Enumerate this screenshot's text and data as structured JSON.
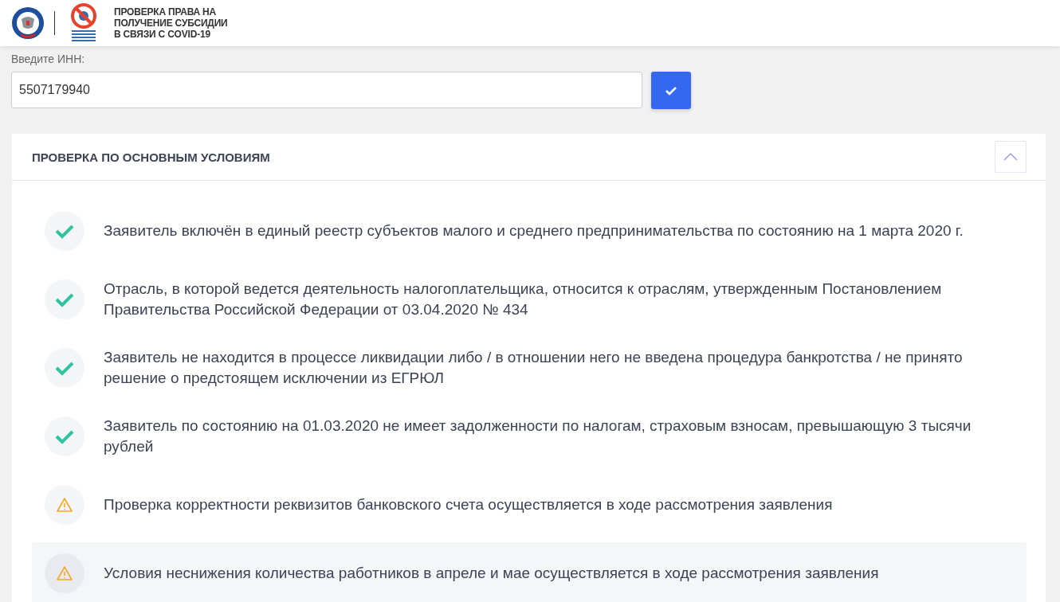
{
  "header": {
    "title_lines": [
      "ПРОВЕРКА ПРАВА НА",
      "ПОЛУЧЕНИЕ СУБСИДИИ",
      "В СВЯЗИ С COVID-19"
    ]
  },
  "inn": {
    "label": "Введите ИНН:",
    "value": "5507179940"
  },
  "section": {
    "title": "ПРОВЕРКА ПО ОСНОВНЫМ УСЛОВИЯМ",
    "expanded": true,
    "items": [
      {
        "kind": "ok",
        "selected": false,
        "text": "Заявитель включён в единый реестр субъектов малого и среднего предпринимательства по состоянию на 1 марта 2020 г."
      },
      {
        "kind": "ok",
        "selected": false,
        "text": "Отрасль, в которой ведется деятельность налогоплательщика, относится к отраслям, утвержденным Постановлением Правительства Российской Федерации от 03.04.2020 № 434"
      },
      {
        "kind": "ok",
        "selected": false,
        "text": "Заявитель не находится в процессе ликвидации либо / в отношении него не введена процедура банкротства / не принято решение о предстоящем исключении из ЕГРЮЛ"
      },
      {
        "kind": "ok",
        "selected": false,
        "text": "Заявитель по состоянию на 01.03.2020 не имеет задолженности по налогам, страховым взносам, превышающую 3 тысячи рублей"
      },
      {
        "kind": "warning",
        "selected": false,
        "text": "Проверка корректности реквизитов банковского счета осуществляется в ходе рассмотрения заявления"
      },
      {
        "kind": "warning",
        "selected": true,
        "text": "Условия неснижения количества работников в апреле и мае осуществляется в ходе рассмотрения заявления"
      }
    ]
  }
}
